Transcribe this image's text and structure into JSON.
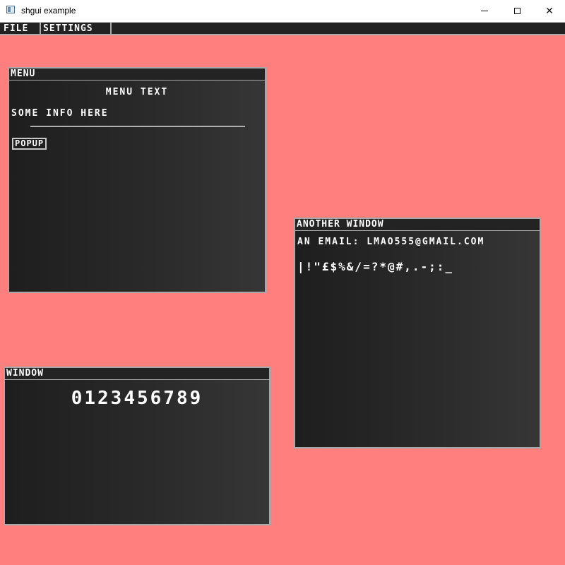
{
  "os_window": {
    "title": "shgui example",
    "minimize_glyph": "minimize-icon",
    "maximize_glyph": "maximize-icon",
    "close_label": "✕"
  },
  "menubar": {
    "items": [
      {
        "label": "FILE"
      },
      {
        "label": "SETTINGS"
      }
    ]
  },
  "windows": {
    "menu": {
      "title": "MENU",
      "heading": "MENU TEXT",
      "info": "SOME INFO HERE",
      "button_label": "POPUP"
    },
    "another": {
      "title": "ANOTHER WINDOW",
      "email_line": "AN EMAIL: LMAO555@GMAIL.COM",
      "symbols": "|!\"£$%&/=?*@#,.-;:_"
    },
    "window": {
      "title": "WINDOW",
      "digits": "0123456789"
    }
  },
  "colors": {
    "desktop_background": "#ff7f7f",
    "window_background": "#222222",
    "window_border": "#a8a8a8",
    "text": "#ffffff"
  }
}
